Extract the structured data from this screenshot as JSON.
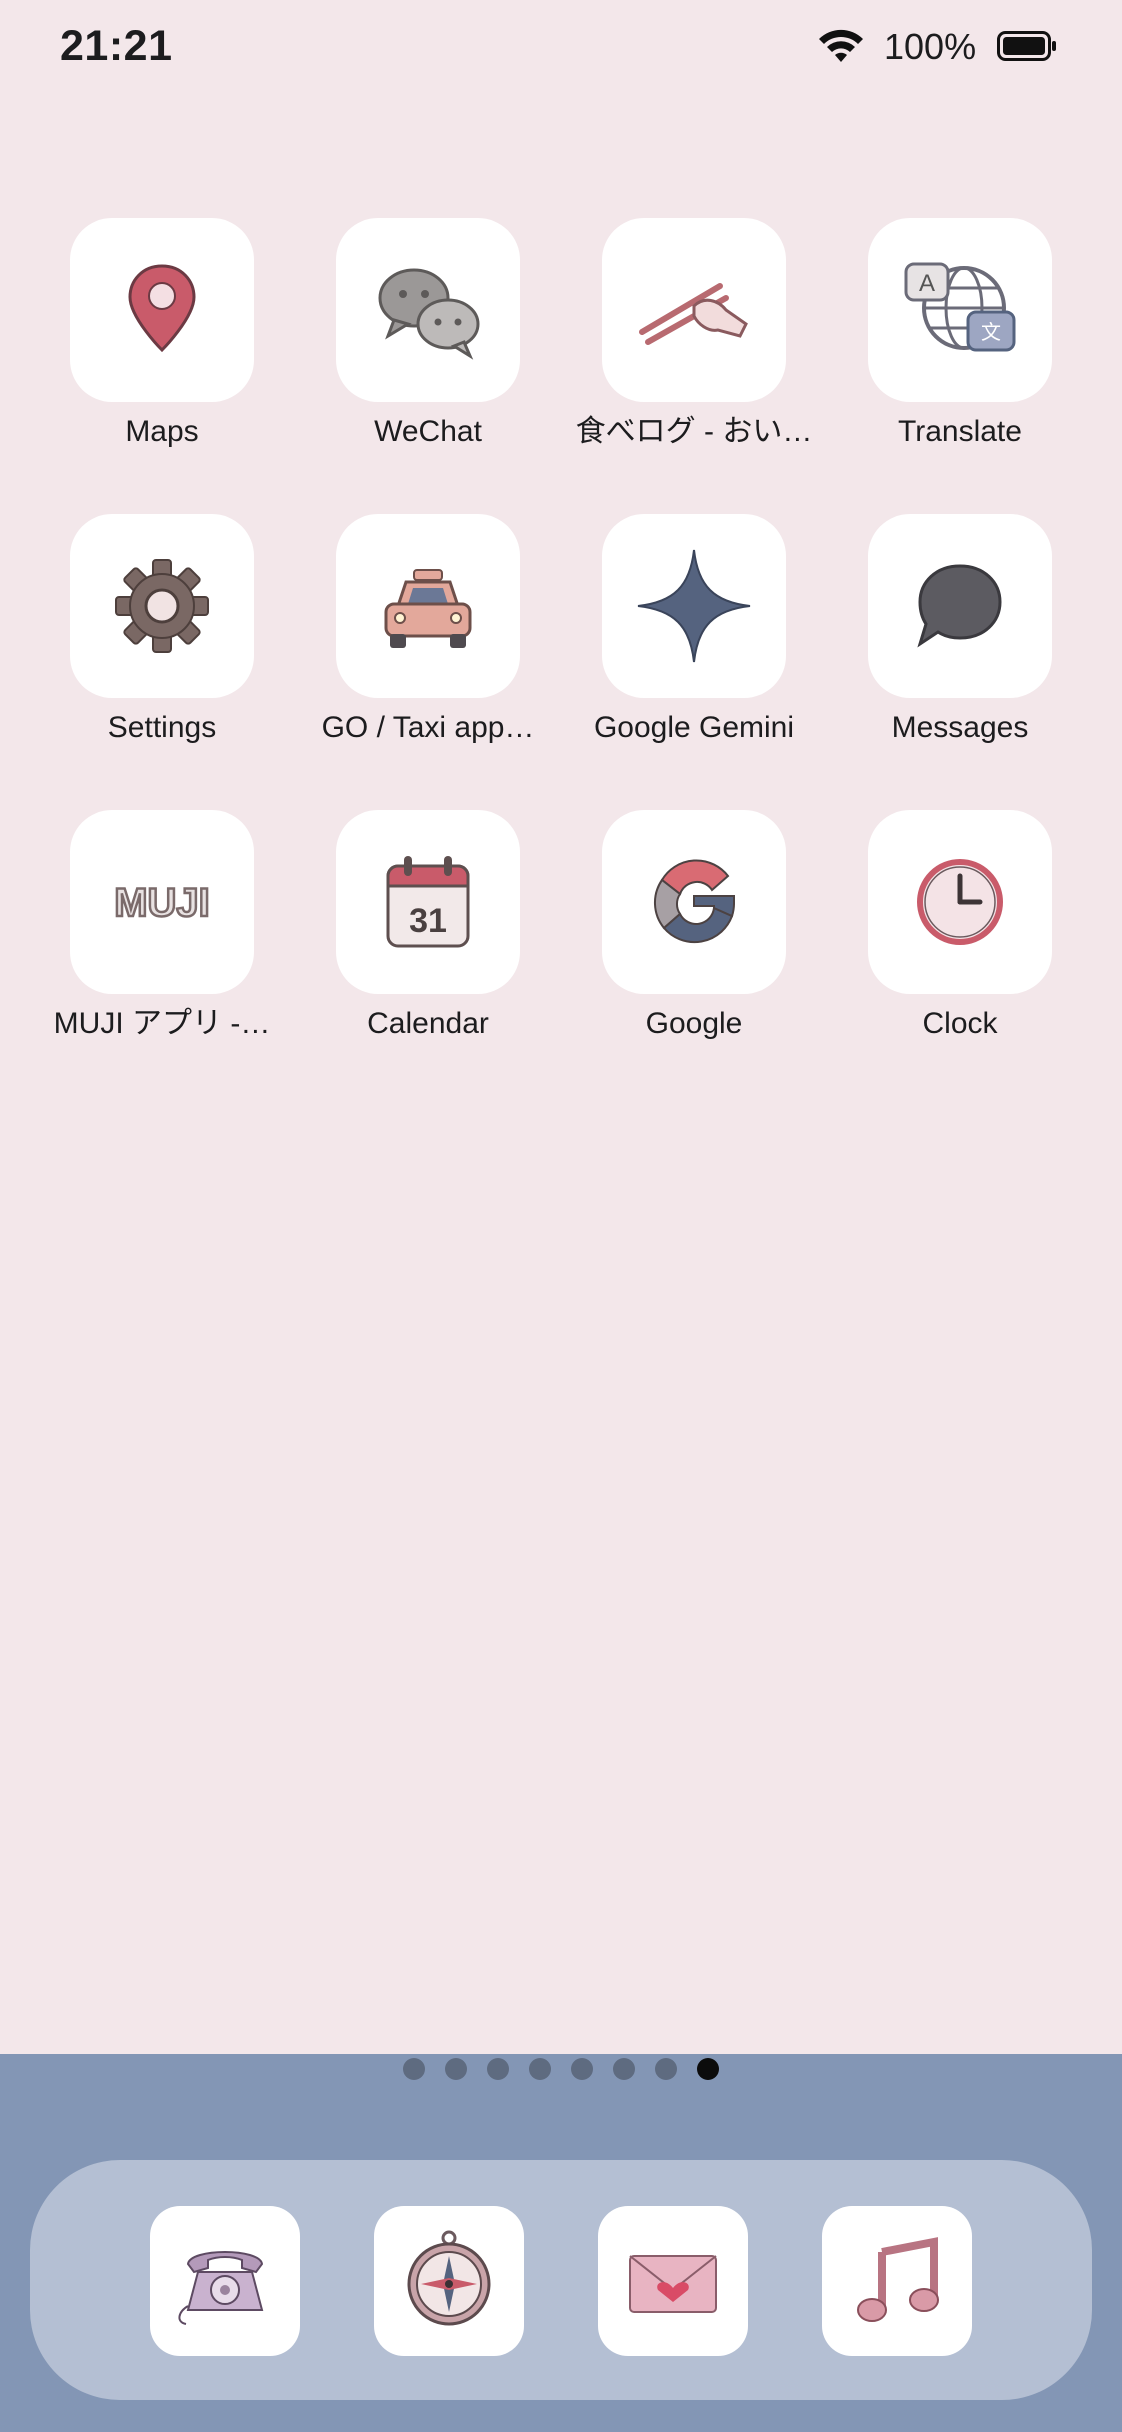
{
  "status_bar": {
    "time": "21:21",
    "battery_percent": "100%",
    "icons": [
      "wifi-icon",
      "battery-icon"
    ]
  },
  "apps": [
    {
      "label": "Maps",
      "icon": "map-pin-icon"
    },
    {
      "label": "WeChat",
      "icon": "chat-bubbles-icon"
    },
    {
      "label": "食べログ - おい…",
      "icon": "chopsticks-icon"
    },
    {
      "label": "Translate",
      "icon": "globe-translate-icon"
    },
    {
      "label": "Settings",
      "icon": "gear-icon"
    },
    {
      "label": "GO / Taxi app…",
      "icon": "taxi-icon"
    },
    {
      "label": "Google Gemini",
      "icon": "sparkle-icon"
    },
    {
      "label": "Messages",
      "icon": "message-bubble-icon"
    },
    {
      "label": "MUJI アプリ -…",
      "icon": "muji-logo-icon",
      "logo_text": "MUJI"
    },
    {
      "label": "Calendar",
      "icon": "calendar-icon",
      "date": "31"
    },
    {
      "label": "Google",
      "icon": "google-g-icon"
    },
    {
      "label": "Clock",
      "icon": "clock-icon"
    }
  ],
  "page_indicator": {
    "count": 8,
    "active_index": 8
  },
  "dock": [
    {
      "icon": "phone-icon"
    },
    {
      "icon": "compass-icon"
    },
    {
      "icon": "mail-icon"
    },
    {
      "icon": "music-icon"
    }
  ],
  "colors": {
    "background": "#f3e7ea",
    "dock_background": "#8396b5",
    "tile": "#ffffff",
    "accent_pink": "#c95b6a",
    "accent_slate": "#55637f"
  }
}
